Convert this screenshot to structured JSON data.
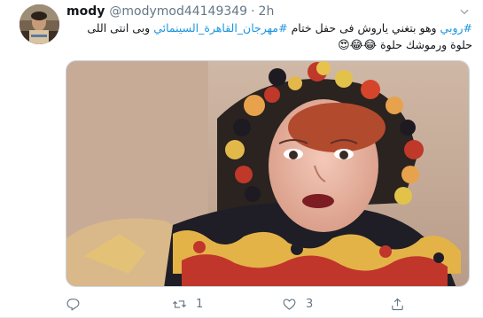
{
  "tweet": {
    "display_name": "mody",
    "handle": "@modymod44149349",
    "separator": "·",
    "time": "2h",
    "text": {
      "hashtag1": "#روبي",
      "part1": " وهو بتغني ياروش فى حفل ختام ",
      "hashtag2": "#مهرجان_القاهرة_السينمائي",
      "part2": "  وبى انتى اللى حلوة ورموشك حلوة ",
      "emojis": "😂😂😍"
    }
  },
  "actions": {
    "reply_count": "",
    "retweet_count": "1",
    "like_count": "3"
  },
  "icons": {
    "more": "chevron-down-icon",
    "reply": "reply-icon",
    "retweet": "retweet-icon",
    "like": "heart-icon",
    "share": "share-icon"
  },
  "colors": {
    "link": "#1b95e0",
    "text": "#14171a",
    "muted": "#657786"
  }
}
